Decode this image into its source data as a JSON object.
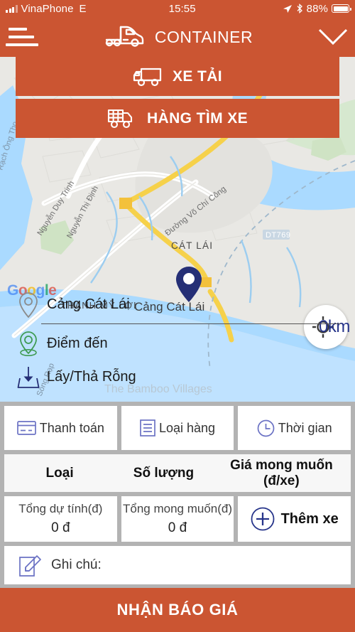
{
  "status_bar": {
    "carrier": "VinaPhone",
    "network": "E",
    "time": "15:55",
    "battery_percent": "88%",
    "icons": [
      "signal-icon",
      "location-arrow-icon",
      "bluetooth-icon",
      "battery-icon"
    ]
  },
  "app_bar": {
    "title": "CONTAINER",
    "menu_icon": "hamburger-icon",
    "truck_icon": "container-truck-icon",
    "expand_icon": "chevron-down-icon"
  },
  "modes": [
    {
      "label": "XE TẢI",
      "icon": "truck-icon"
    },
    {
      "label": "HÀNG TÌM XE",
      "icon": "cargo-truck-icon"
    }
  ],
  "map": {
    "attribution": "Google",
    "gps_label": "0km",
    "gps_icon": "crosshair-icon",
    "marker_icon": "map-pin-icon",
    "labels": [
      "CÁT LÁI",
      "THẠNH MỸ LỢI",
      "Cảng Cát Lái",
      "The Bamboo Villages",
      "Đường Võ Chí Công",
      "Nguyễn Thị Định",
      "Nguyễn Duy Trinh",
      "DT769",
      "Rạch Ông Thọ"
    ]
  },
  "address": {
    "origin": {
      "text": "Cảng Cát Lái",
      "icon": "origin-pin-icon"
    },
    "destination": {
      "text": "Điểm đến",
      "icon": "destination-pin-icon"
    },
    "empty_container": {
      "text": "Lấy/Thả Rỗng",
      "icon": "download-tray-icon"
    }
  },
  "options": [
    {
      "label": "Thanh toán",
      "icon": "credit-card-icon"
    },
    {
      "label": "Loại hàng",
      "icon": "list-icon"
    },
    {
      "label": "Thời gian",
      "icon": "clock-icon"
    }
  ],
  "table_header": [
    "Loại",
    "Số lượng",
    "Giá mong muốn (đ/xe)"
  ],
  "totals": [
    {
      "label": "Tổng dự tính(đ)",
      "value": "0 đ"
    },
    {
      "label": "Tổng mong muốn(đ)",
      "value": "0 đ"
    }
  ],
  "add_vehicle": {
    "label": "Thêm xe",
    "icon": "plus-circle-icon"
  },
  "note": {
    "label": "Ghi chú:",
    "icon": "note-pencil-icon"
  },
  "cta": {
    "label": "NHẬN BÁO GIÁ"
  },
  "colors": {
    "brand_orange": "#cb5532",
    "panel_gray": "#b3b3b3",
    "accent_blue": "#26348a",
    "icon_blue": "#6b72c4",
    "pin_navy": "#252f76",
    "green_pin": "#3f9b52"
  }
}
